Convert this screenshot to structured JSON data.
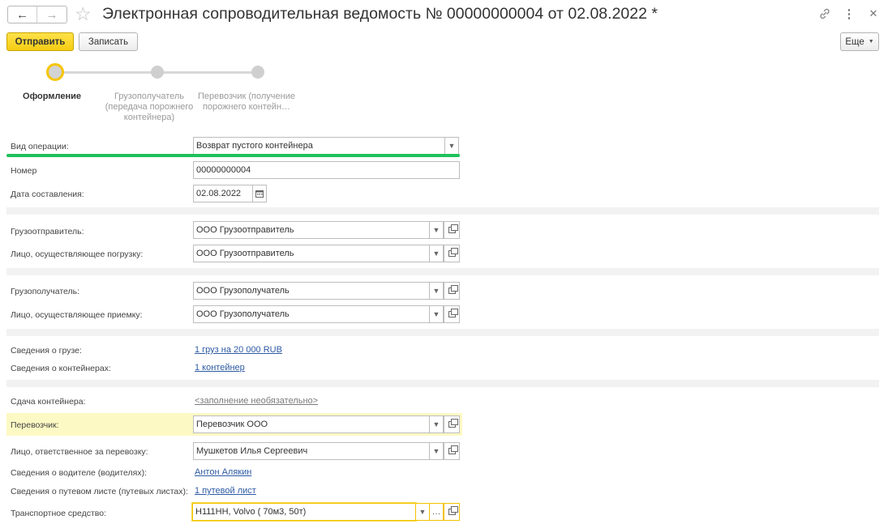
{
  "window": {
    "title": "Электронная сопроводительная ведомость № 00000000004 от 02.08.2022 *",
    "back_icon": "arrow-left-icon",
    "forward_icon": "arrow-right-icon",
    "favorite_icon": "star-icon",
    "link_icon": "link-icon",
    "menu_icon": "more-vertical-icon",
    "close_icon": "close-icon"
  },
  "toolbar": {
    "send_label": "Отправить",
    "save_label": "Записать",
    "more_label": "Еще"
  },
  "stepper": {
    "steps": [
      {
        "label": "Оформление",
        "active": true
      },
      {
        "label": "Грузополучатель (передача порожнего контейнера)",
        "active": false
      },
      {
        "label": "Перевозчик (получение порожнего контейн…",
        "active": false
      }
    ]
  },
  "form": {
    "operation_type": {
      "label": "Вид операции:",
      "value": "Возврат пустого контейнера"
    },
    "number": {
      "label": "Номер",
      "value": "00000000004"
    },
    "date": {
      "label": "Дата составления:",
      "value": "02.08.2022"
    },
    "shipper": {
      "label": "Грузоотправитель:",
      "value": "ООО Грузоотправитель"
    },
    "loader": {
      "label": "Лицо, осуществляющее погрузку:",
      "value": "ООО Грузоотправитель"
    },
    "consignee": {
      "label": "Грузополучатель:",
      "value": "ООО Грузополучатель"
    },
    "receiver": {
      "label": "Лицо, осуществляющее приемку:",
      "value": "ООО Грузополучатель"
    },
    "cargo_info": {
      "label": "Сведения о грузе:",
      "value": "1 груз на 20 000 RUB"
    },
    "container_info": {
      "label": "Сведения о контейнерах:",
      "value": "1 контейнер"
    },
    "container_delivery": {
      "label": "Сдача контейнера:",
      "value": "<заполнение необязательно>"
    },
    "carrier": {
      "label": "Перевозчик:",
      "value": "Перевозчик ООО"
    },
    "responsible": {
      "label": "Лицо, ответственное за перевозку:",
      "value": "Мушкетов Илья Сергеевич"
    },
    "drivers": {
      "label": "Сведения о водителе (водителях):",
      "value": "Антон Алякин"
    },
    "waybills": {
      "label": "Сведения о путевом листе (путевых листах):",
      "value": "1 путевой лист"
    },
    "vehicle": {
      "label": "Транспортное средство:",
      "value": "Н111НН, Volvo ( 70м3, 50т)"
    }
  },
  "colors": {
    "accent_yellow": "#f6c500",
    "highlight_row": "#fdf9c4",
    "link_blue": "#2d5aa3",
    "green_underline": "#20c05c"
  }
}
